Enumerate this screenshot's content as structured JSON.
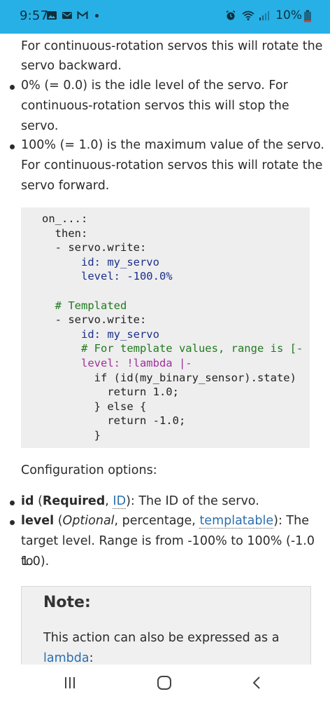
{
  "status_bar": {
    "time": "9:57",
    "battery": "10%",
    "dot": "•"
  },
  "content": {
    "para_cont": "For continuous-rotation servos this will rotate the servo backward.",
    "bullets": [
      {
        "line1": "0% (= 0.0) is the idle level of the servo. For",
        "line2": "continuous-rotation servos this will stop the",
        "line3": "servo."
      },
      {
        "line1": "100% (= 1.0) is the maximum value of the servo.",
        "line2": "For continuous-rotation servos this will rotate the",
        "line3": "servo forward."
      }
    ],
    "line_top1": "For continuous-rotation servos this will rotate the",
    "line_top2": "servo backward.",
    "code_lines": [
      "on_...:",
      "  then:",
      "  - servo.write:",
      "      id: my_servo",
      "      level: -100.0%",
      "",
      "  # Templated",
      "  - servo.write:",
      "      id: my_servo",
      "      # For template values, range is [-",
      "      level: !lambda |-",
      "        if (id(my_binary_sensor).state)",
      "          return 1.0;",
      "        } else {",
      "          return -1.0;",
      "        }"
    ],
    "config_heading": "Configuration options:",
    "options": [
      {
        "name": "id",
        "open": " (",
        "qualifier": "Required",
        "sep": ", ",
        "link": "ID",
        "rest": "): The ID of the servo."
      },
      {
        "name": "level",
        "open": " (",
        "qualifier": "Optional",
        "sep": ", percentage, ",
        "link": "templatable",
        "rest": "): The",
        "line2": "target level. Range is from -100% to 100% (-1.0 to",
        "line3": "1.0)."
      }
    ],
    "note": {
      "title": "Note:",
      "line1": "This action can also be expressed as a",
      "link": "lambda",
      "colon": ":"
    }
  },
  "colors": {
    "status_bar": "#27b0e6",
    "code_bg": "#eeeeee",
    "link": "#2a6fb0",
    "note_bg": "#f0f0f0"
  },
  "nav_icons": [
    "recents-icon",
    "home-icon",
    "back-icon"
  ]
}
